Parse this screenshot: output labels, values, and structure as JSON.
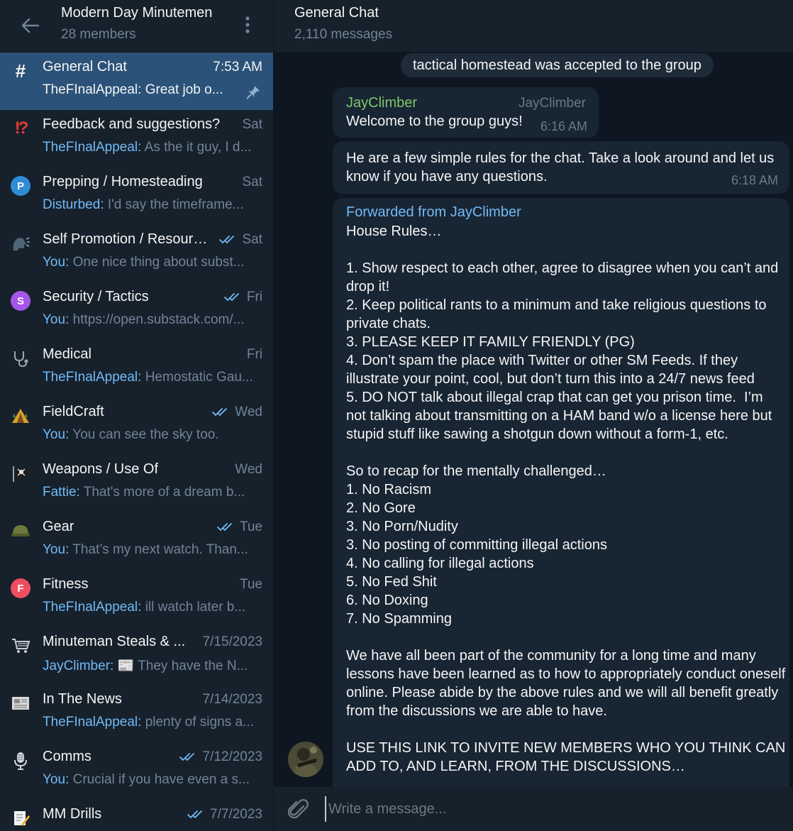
{
  "sidebar": {
    "group_title": "Modern Day Minutemen",
    "group_sub": "28 members",
    "topics": [
      {
        "icon": "hash-icon",
        "name": "General Chat",
        "time": "7:53 AM",
        "sender": "",
        "preview": "TheFInalAppeal: Great job o...",
        "read": false,
        "pinned": true
      },
      {
        "icon": "exclamation-icon",
        "name": "Feedback and suggestions?",
        "time": "Sat",
        "sender": "TheFInalAppeal:",
        "preview": " As the it guy, I d...",
        "read": false,
        "pinned": false
      },
      {
        "icon": "letter-p-icon",
        "name": "Prepping / Homesteading",
        "time": "Sat",
        "sender": "Disturbed:",
        "preview": " I'd say the timeframe...",
        "read": false,
        "pinned": false
      },
      {
        "icon": "speaking-head-icon",
        "name": "Self Promotion / Resourc...",
        "time": "Sat",
        "sender": "You:",
        "preview": " One nice thing about subst...",
        "read": true,
        "pinned": false
      },
      {
        "icon": "letter-s-icon",
        "name": "Security / Tactics",
        "time": "Fri",
        "sender": "You:",
        "preview": " https://open.substack.com/...",
        "read": true,
        "pinned": false
      },
      {
        "icon": "stethoscope-icon",
        "name": "Medical",
        "time": "Fri",
        "sender": "TheFInalAppeal:",
        "preview": " Hemostatic Gau...",
        "read": false,
        "pinned": false
      },
      {
        "icon": "tent-icon",
        "name": "FieldCraft",
        "time": "Wed",
        "sender": "You:",
        "preview": " You can see the sky too.",
        "read": true,
        "pinned": false
      },
      {
        "icon": "pirate-flag-icon",
        "name": "Weapons / Use Of",
        "time": "Wed",
        "sender": "Fattie:",
        "preview": " That's more of a dream b...",
        "read": false,
        "pinned": false
      },
      {
        "icon": "helmet-icon",
        "name": "Gear",
        "time": "Tue",
        "sender": "You:",
        "preview": " That’s my next watch.  Than...",
        "read": true,
        "pinned": false
      },
      {
        "icon": "letter-f-icon",
        "name": "Fitness",
        "time": "Tue",
        "sender": "TheFInalAppeal:",
        "preview": " ill watch later b...",
        "read": false,
        "pinned": false
      },
      {
        "icon": "shopping-cart-icon",
        "name": "Minuteman Steals & ...",
        "time": "7/15/2023",
        "sender": "JayClimber:",
        "preview": " 📰 They have the N...",
        "read": false,
        "pinned": false
      },
      {
        "icon": "newspaper-icon",
        "name": "In The News",
        "time": "7/14/2023",
        "sender": "TheFInalAppeal:",
        "preview": " plenty of signs a...",
        "read": false,
        "pinned": false
      },
      {
        "icon": "microphone-icon",
        "name": "Comms",
        "time": "7/12/2023",
        "sender": "You:",
        "preview": " Crucial if you have even a s...",
        "read": true,
        "pinned": false
      },
      {
        "icon": "memo-icon",
        "name": "MM Drills",
        "time": "7/7/2023",
        "sender": "",
        "preview": "",
        "read": true,
        "pinned": false
      }
    ]
  },
  "chat": {
    "title": "General Chat",
    "subtitle": "2,110 messages",
    "service_message": "tactical homestead was accepted to the group",
    "msg1": {
      "author": "JayClimber",
      "tag": "JayClimber",
      "text": "Welcome to the group guys!",
      "time": "6:16 AM"
    },
    "msg2": {
      "text": "He are a few simple rules for the chat. Take a look around and let us know if you have any questions.",
      "time": "6:18 AM"
    },
    "msg3": {
      "forwarded": "Forwarded from JayClimber",
      "lines": [
        "House Rules…",
        "",
        "1. Show respect to each other, agree to disagree when you can’t and drop it!",
        "2. Keep political rants to a minimum and take religious questions to private chats.",
        "3. PLEASE KEEP IT FAMILY FRIENDLY (PG)",
        "4. Don’t spam the place with Twitter or other SM Feeds. If they illustrate your point, cool, but don’t turn this into a 24/7 news feed",
        "5. DO NOT talk about illegal crap that can get you prison time.  I’m not talking about transmitting on a HAM band w/o a license here but stupid stuff like sawing a shotgun down without a form-1, etc.",
        "",
        "So to recap for the mentally challenged…",
        "1. No Racism",
        "2. No Gore",
        "3. No Porn/Nudity",
        "3. No posting of committing illegal actions",
        "4. No calling for illegal actions",
        "5. No Fed Shit",
        "6. No Doxing",
        "7. No Spamming",
        "",
        "We have all been part of the community for a long time and many lessons have been learned as to how to appropriately conduct oneself online. Please abide by the above rules and we will all benefit greatly from the discussions we are able to have.",
        "",
        "USE THIS LINK TO INVITE NEW MEMBERS WHO YOU THINK CAN ADD TO, AND LEARN, FROM THE DISCUSSIONS…"
      ]
    },
    "composer_placeholder": "Write a message..."
  },
  "colors": {
    "sidebar_bg": "#17212b",
    "chat_bg": "#0e1621",
    "active_topic": "#2b5278",
    "accent_blue": "#71baf7",
    "muted": "#708499",
    "author_green": "#7ec86a",
    "bubble": "#182533"
  }
}
